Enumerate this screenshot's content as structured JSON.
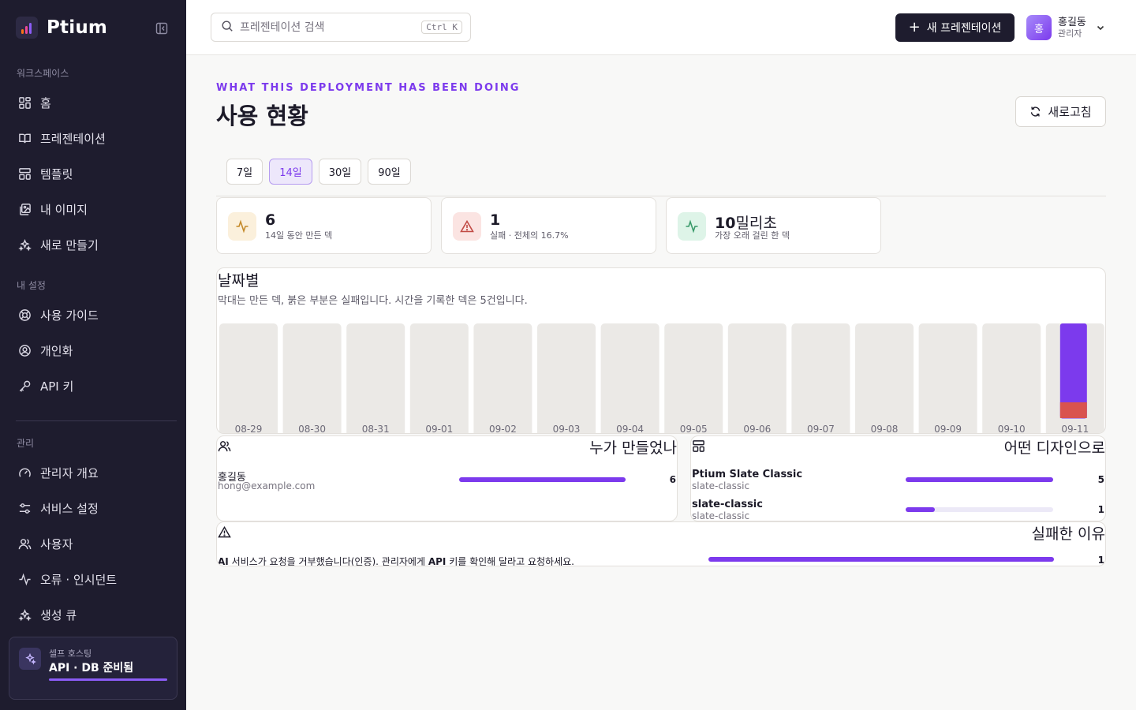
{
  "brand": {
    "name": "Ptium"
  },
  "sidebar": {
    "workspace_label": "워크스페이스",
    "workspace_items": [
      {
        "label": "홈",
        "icon": "home-grid-icon"
      },
      {
        "label": "프레젠테이션",
        "icon": "book-open-icon"
      },
      {
        "label": "템플릿",
        "icon": "layout-template-icon"
      },
      {
        "label": "내 이미지",
        "icon": "images-icon"
      },
      {
        "label": "새로 만들기",
        "icon": "sparkles-icon"
      }
    ],
    "settings_label": "내 설정",
    "settings_items": [
      {
        "label": "사용 가이드",
        "icon": "lifebuoy-icon"
      },
      {
        "label": "개인화",
        "icon": "user-circle-icon"
      },
      {
        "label": "API 키",
        "icon": "key-icon"
      }
    ],
    "admin_label": "관리",
    "admin_items": [
      {
        "label": "관리자 개요",
        "icon": "gauge-icon"
      },
      {
        "label": "서비스 설정",
        "icon": "sliders-icon"
      },
      {
        "label": "사용자",
        "icon": "users-icon"
      },
      {
        "label": "오류 · 인시던트",
        "icon": "activity-icon"
      },
      {
        "label": "생성 큐",
        "icon": "sparkles-icon"
      }
    ],
    "status": {
      "sub": "셀프 호스팅",
      "main": "API · DB 준비됨"
    }
  },
  "header": {
    "search_placeholder": "프레젠테이션 검색",
    "search_shortcut": "Ctrl K",
    "new_button": "새 프레젠테이션",
    "user": {
      "initial": "홍",
      "name": "홍길동",
      "role": "관리자"
    }
  },
  "page": {
    "eyebrow": "WHAT THIS DEPLOYMENT HAS BEEN DOING",
    "title": "사용 현황",
    "refresh": "새로고침",
    "ranges": [
      "7일",
      "14일",
      "30일",
      "90일"
    ],
    "active_range": "14일"
  },
  "stats": [
    {
      "value": "6",
      "unit": "",
      "label": "14일 동안 만든 덱",
      "icon": "activity-icon",
      "color": "#c58a2b",
      "bg": "#fbf0dc"
    },
    {
      "value": "1",
      "unit": "",
      "label": "실패 · 전체의 16.7%",
      "icon": "alert-triangle-icon",
      "color": "#c24b45",
      "bg": "#fbe4e2"
    },
    {
      "value": "10",
      "unit": "밀리초",
      "label": "가장 오래 걸린 한 덱",
      "icon": "activity-icon",
      "color": "#3a9a6a",
      "bg": "#def4e8"
    }
  ],
  "chart_data": {
    "type": "bar",
    "title": "날짜별",
    "description": "막대는 만든 덱, 붉은 부분은 실패입니다. 시간을 기록한 덱은 5건입니다.",
    "categories": [
      "08-29",
      "08-30",
      "08-31",
      "09-01",
      "09-02",
      "09-03",
      "09-04",
      "09-05",
      "09-06",
      "09-07",
      "09-08",
      "09-09",
      "09-10",
      "09-11"
    ],
    "series": [
      {
        "values": [
          0,
          0,
          0,
          0,
          0,
          0,
          0,
          0,
          0,
          0,
          0,
          0,
          0,
          6
        ],
        "color": "#7c3aed"
      },
      {
        "values": [
          0,
          0,
          0,
          0,
          0,
          0,
          0,
          0,
          0,
          0,
          0,
          0,
          0,
          1
        ],
        "color": "#d9534f"
      }
    ],
    "ylim": [
      0,
      6
    ],
    "grid": false
  },
  "creators": {
    "title": "누가 만들었나",
    "rows": [
      {
        "name": "홍길동",
        "sub": "hong@example.com",
        "count": "6",
        "fraction": 1.0
      }
    ]
  },
  "designs": {
    "title": "어떤 디자인으로",
    "rows": [
      {
        "name": "Ptium Slate Classic",
        "sub": "slate-classic",
        "count": "5",
        "fraction": 1.0
      },
      {
        "name": "slate-classic",
        "sub": "slate-classic",
        "count": "1",
        "fraction": 0.2
      }
    ]
  },
  "failures": {
    "title": "실패한 이유",
    "rows": [
      {
        "prefix": "AI",
        "mid1": " 서비스가 요청을 거부했습니다(인증). 관리자에게 ",
        "key": "API",
        "suffix": " 키를 확인해 달라고 요청하세요.",
        "count": "1",
        "fraction": 1.0
      }
    ]
  }
}
